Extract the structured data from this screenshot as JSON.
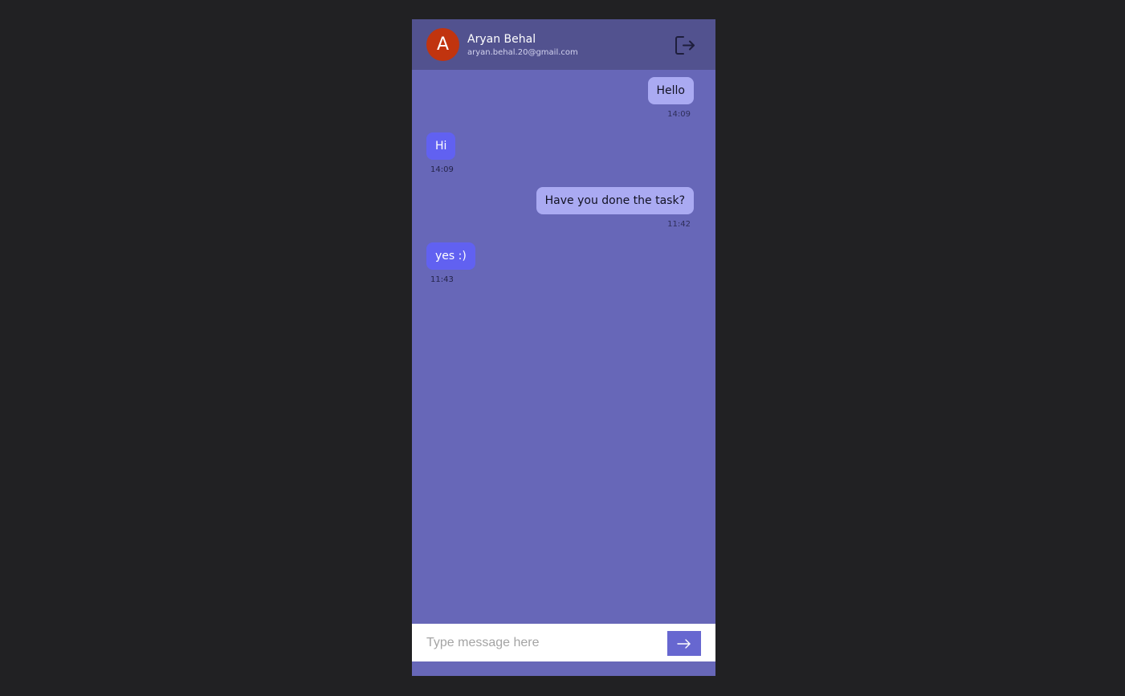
{
  "header": {
    "avatar_initial": "A",
    "user_name": "Aryan Behal",
    "user_email": "aryan.behal.20@gmail.com",
    "logout_icon": "logout-icon"
  },
  "messages": [
    {
      "direction": "sent",
      "text": "Hello",
      "time": "14:09"
    },
    {
      "direction": "received",
      "text": "Hi",
      "time": "14:09"
    },
    {
      "direction": "sent",
      "text": "Have you done the task?",
      "time": "11:42"
    },
    {
      "direction": "received",
      "text": "yes :)",
      "time": "11:43"
    }
  ],
  "composer": {
    "placeholder": "Type message here",
    "value": "",
    "send_icon": "arrow-right-icon"
  },
  "colors": {
    "page_background": "#212123",
    "chat_background": "#6767b8",
    "header_background": "#52528f",
    "avatar": "#c1340f",
    "sent_bubble": "#aaaaf2",
    "received_bubble": "#6161f1",
    "send_button": "#6767d0"
  }
}
